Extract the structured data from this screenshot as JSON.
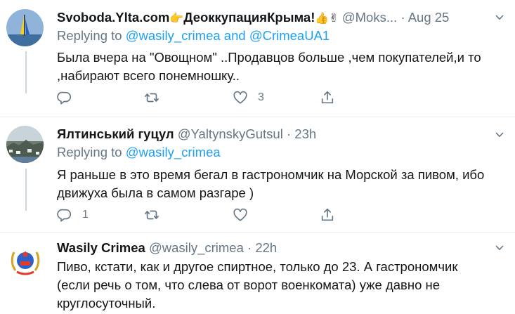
{
  "tweets": [
    {
      "name": "Svoboda.Ylta.com",
      "name_emoji_1": "👉",
      "name_2": "ДеоккупацияКрыма!",
      "name_emoji_2": "👍✌",
      "handle": "@Moks...",
      "dot": "·",
      "time": "Aug 25",
      "replying_prefix": "Replying to",
      "replying_to_1": "@wasily_crimea",
      "replying_and": "and",
      "replying_to_2": "@CrimeaUA1",
      "text": "Была вчера на \"Овощном\" ..Продавцов больше ,чем покупателей,и  то ,набирают всего понемношку..",
      "counts": {
        "reply": "",
        "retweet": "",
        "like": "3"
      }
    },
    {
      "name": "Ялтинський гуцул",
      "handle": "@YaltynskyGutsul",
      "dot": "·",
      "time": "23h",
      "replying_prefix": "Replying to",
      "replying_to_1": "@wasily_crimea",
      "text": "Я раньше в это время бегал в гастрономчик на Морской за пивом, ибо движуха была в самом разгаре )",
      "counts": {
        "reply": "1",
        "retweet": "",
        "like": ""
      }
    },
    {
      "name": "Wasily Crimea",
      "handle": "@wasily_crimea",
      "dot": "·",
      "time": "22h",
      "text": "Пиво, кстати, как и другое спиртное, только до 23. А гастрономчик (если речь о том, что слева от ворот военкомата) уже давно не круглосуточный."
    }
  ],
  "colors": {
    "accent": "#1da1f2",
    "secondary": "#657786",
    "divider": "#e6ecf0",
    "thread": "#ccd6dd"
  },
  "icons": [
    "reply-icon",
    "retweet-icon",
    "like-icon",
    "share-icon",
    "chevron-down-icon"
  ]
}
